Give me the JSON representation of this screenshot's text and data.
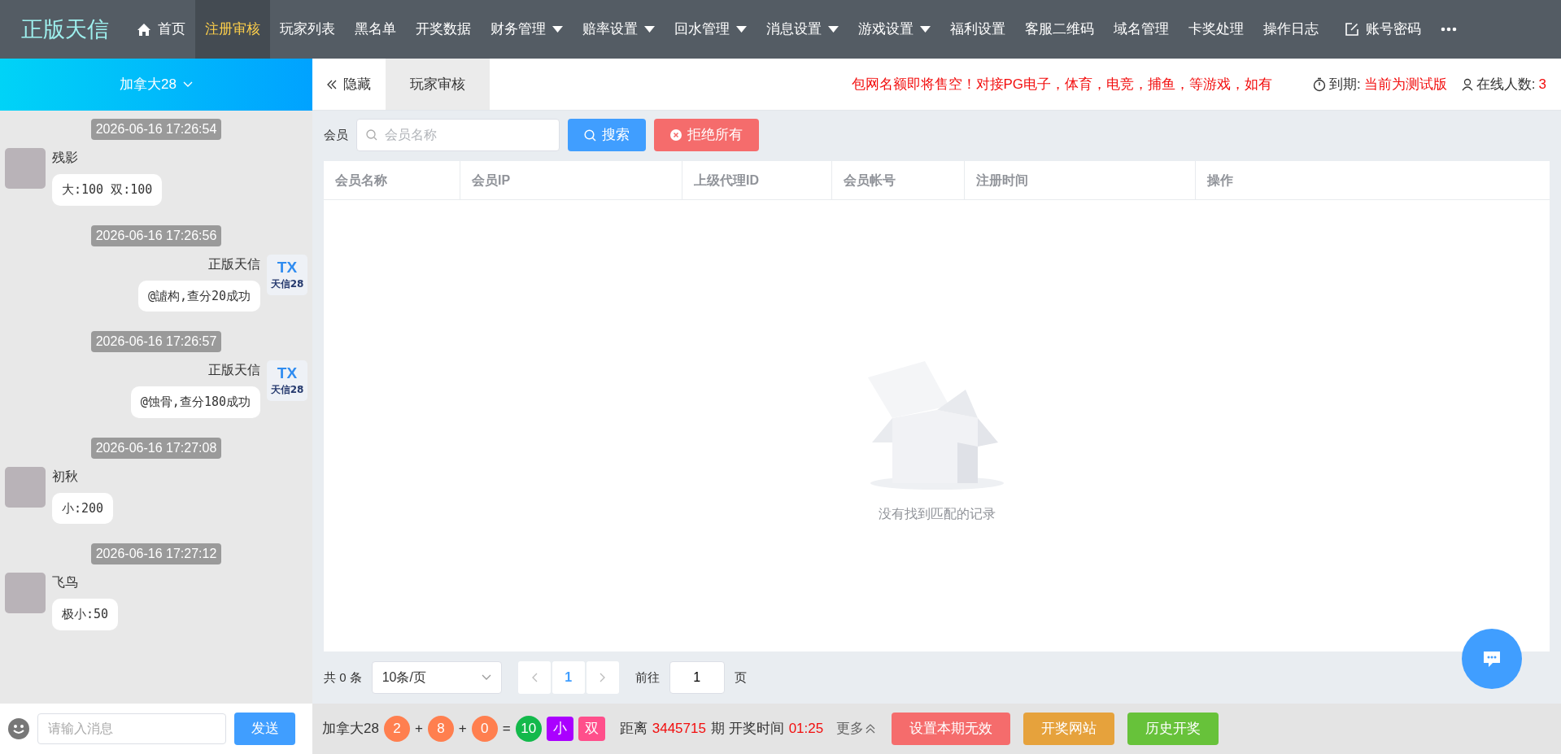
{
  "brand": "正版天信",
  "nav": [
    {
      "label": "首页",
      "kind": "home-link",
      "selected": false
    },
    {
      "label": "注册审核",
      "kind": "link",
      "selected": true
    },
    {
      "label": "玩家列表",
      "kind": "link",
      "selected": false
    },
    {
      "label": "黑名单",
      "kind": "link",
      "selected": false
    },
    {
      "label": "开奖数据",
      "kind": "link",
      "selected": false
    },
    {
      "label": "财务管理",
      "kind": "dropdown",
      "selected": false
    },
    {
      "label": "赔率设置",
      "kind": "dropdown",
      "selected": false
    },
    {
      "label": "回水管理",
      "kind": "dropdown",
      "selected": false
    },
    {
      "label": "消息设置",
      "kind": "dropdown",
      "selected": false
    },
    {
      "label": "游戏设置",
      "kind": "dropdown",
      "selected": false
    },
    {
      "label": "福利设置",
      "kind": "link",
      "selected": false
    },
    {
      "label": "客服二维码",
      "kind": "link",
      "selected": false
    },
    {
      "label": "域名管理",
      "kind": "link",
      "selected": false
    },
    {
      "label": "卡奖处理",
      "kind": "link",
      "selected": false
    },
    {
      "label": "操作日志",
      "kind": "link",
      "selected": false
    },
    {
      "label": "账号密码",
      "kind": "account-link",
      "selected": false
    },
    {
      "kind": "more",
      "selected": false
    }
  ],
  "chat": {
    "room": "加拿大28",
    "messages": [
      {
        "kind": "incoming",
        "time": "2026-06-16 17:26:54",
        "sender": "残影",
        "text": "大:100 双:100"
      },
      {
        "kind": "outgoing",
        "time": "2026-06-16 17:26:56",
        "sender": "正版天信",
        "logo_text": [
          "TX",
          "天信28"
        ],
        "text": "@謯构,查分20成功"
      },
      {
        "kind": "outgoing",
        "time": "2026-06-16 17:26:57",
        "sender": "正版天信",
        "logo_text": [
          "TX",
          "天信28"
        ],
        "text": "@蚀骨,查分180成功"
      },
      {
        "kind": "incoming",
        "time": "2026-06-16 17:27:08",
        "sender": "初秋",
        "text": "小:200"
      },
      {
        "kind": "incoming",
        "time": "2026-06-16 17:27:12",
        "sender": "飞鸟",
        "text": "极小:50"
      }
    ],
    "input": {
      "placeholder": "请输入消息"
    },
    "send": "发送"
  },
  "tabbar": {
    "hide": "隐藏",
    "tabs": [
      {
        "label": "玩家审核",
        "selected": true
      }
    ],
    "notice": "包网名额即将售空！对接PG电子，体育，电竞，捕鱼，等游戏，如有",
    "expiry_label": "到期:",
    "expiry_value": "当前为测试版",
    "online_label": "在线人数:",
    "online_value": "3"
  },
  "filter": {
    "label": "会员",
    "search": {
      "placeholder": "会员名称"
    },
    "search_button": "搜索",
    "reject_button": "拒绝所有"
  },
  "table": {
    "columns": [
      "会员名称",
      "会员IP",
      "上级代理ID",
      "会员帐号",
      "注册时间",
      "操作"
    ],
    "empty": "没有找到匹配的记录"
  },
  "pagination": {
    "total": "共 0 条",
    "page_size": "10条/页",
    "pages": [
      {
        "label": "1",
        "selected": true
      }
    ],
    "goto": "前往",
    "goto_value": "1",
    "page_word": "页"
  },
  "draw": {
    "game": "加拿大28",
    "result": [
      {
        "kind": "ball",
        "text": "2",
        "color": "#ff7f4f"
      },
      {
        "kind": "op",
        "text": "+"
      },
      {
        "kind": "ball",
        "text": "8",
        "color": "#ff7f4f"
      },
      {
        "kind": "op",
        "text": "+"
      },
      {
        "kind": "ball",
        "text": "0",
        "color": "#ff7f4f"
      },
      {
        "kind": "op",
        "text": "="
      },
      {
        "kind": "ball",
        "text": "10",
        "color": "#13b94b"
      },
      {
        "kind": "tag",
        "text": "小",
        "color": "#aa00ff"
      },
      {
        "kind": "tag",
        "text": "双",
        "color": "#ff4f8b"
      }
    ],
    "distance_label": "距离",
    "issue": "3445715",
    "time_label": "期 开奖时间",
    "countdown": "01:25",
    "more": "更多",
    "buttons": [
      {
        "label": "设置本期无效",
        "color": "#f56c6c"
      },
      {
        "label": "开奖网站",
        "color": "#e6a23c"
      },
      {
        "label": "历史开奖",
        "color": "#67c23a"
      }
    ]
  }
}
